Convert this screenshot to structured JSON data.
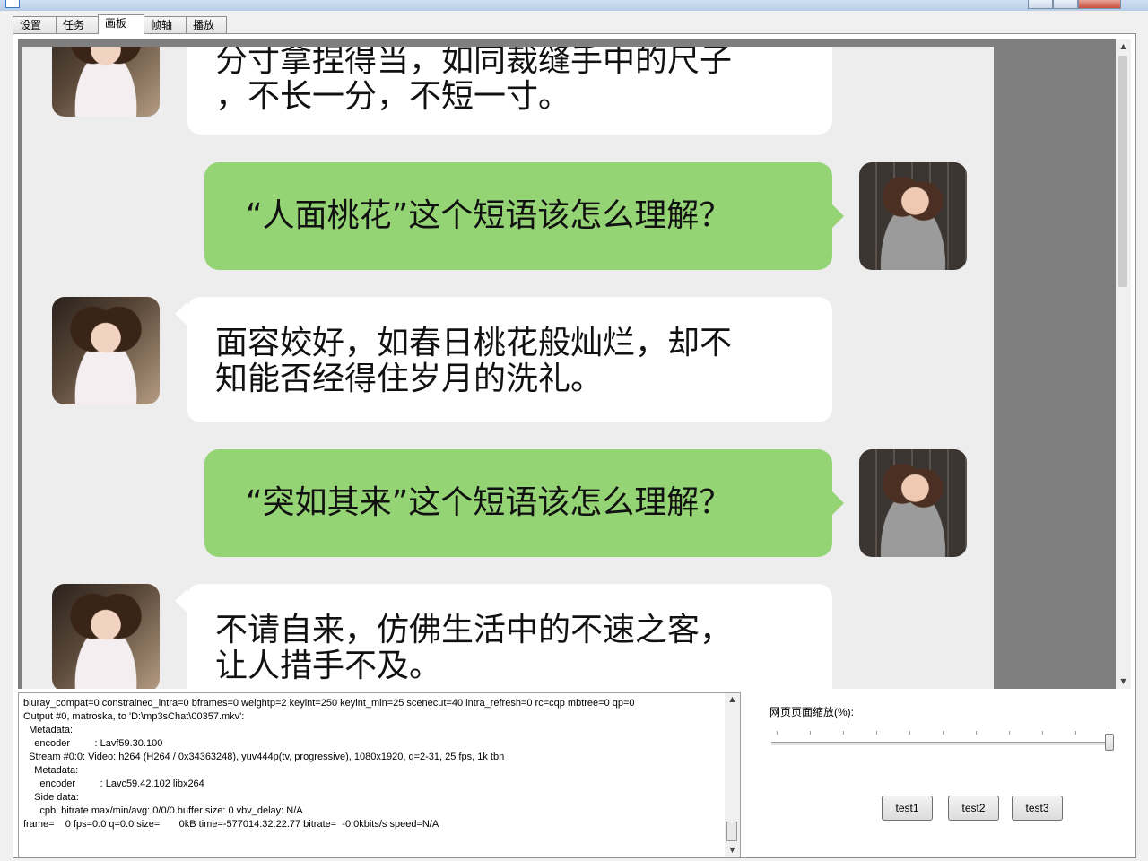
{
  "tabs": [
    {
      "label": "设置",
      "active": false
    },
    {
      "label": "任务",
      "active": false
    },
    {
      "label": "画板",
      "active": true
    },
    {
      "label": "帧轴",
      "active": false
    },
    {
      "label": "播放",
      "active": false
    }
  ],
  "chat": {
    "messages": [
      {
        "side": "left",
        "text": "分寸拿捏得当，如同裁缝手中的尺子\n，不长一分，不短一寸。",
        "avatar": "female-avatar-white-dress"
      },
      {
        "side": "right",
        "text": "“人面桃花”这个短语该怎么理解？",
        "avatar": "female-avatar-grey-sweater"
      },
      {
        "side": "left",
        "text": "面容姣好，如春日桃花般灿烂，却不\n知能否经得住岁月的洗礼。",
        "avatar": "female-avatar-white-dress"
      },
      {
        "side": "right",
        "text": "“突如其来”这个短语该怎么理解？",
        "avatar": "female-avatar-grey-sweater"
      },
      {
        "side": "left",
        "text": "不请自来，仿佛生活中的不速之客，\n让人措手不及。",
        "avatar": "female-avatar-white-dress"
      }
    ],
    "colors": {
      "background": "#ededed",
      "left_bubble": "#ffffff",
      "right_bubble": "#95d475",
      "frame": "#7f7f7f"
    }
  },
  "log": {
    "lines": [
      "bluray_compat=0 constrained_intra=0 bframes=0 weightp=2 keyint=250 keyint_min=25 scenecut=40 intra_refresh=0 rc=cqp mbtree=0 qp=0",
      "Output #0, matroska, to 'D:\\mp3sChat\\00357.mkv':",
      "  Metadata:",
      "    encoder         : Lavf59.30.100",
      "  Stream #0:0: Video: h264 (H264 / 0x34363248), yuv444p(tv, progressive), 1080x1920, q=2-31, 25 fps, 1k tbn",
      "    Metadata:",
      "      encoder         : Lavc59.42.102 libx264",
      "    Side data:",
      "      cpb: bitrate max/min/avg: 0/0/0 buffer size: 0 vbv_delay: N/A",
      "frame=    0 fps=0.0 q=0.0 size=       0kB time=-577014:32:22.77 bitrate=  -0.0kbits/s speed=N/A"
    ]
  },
  "zoom": {
    "label": "网页页面缩放(%):",
    "value_fraction": 1.0
  },
  "buttons": {
    "test1": "test1",
    "test2": "test2",
    "test3": "test3"
  }
}
